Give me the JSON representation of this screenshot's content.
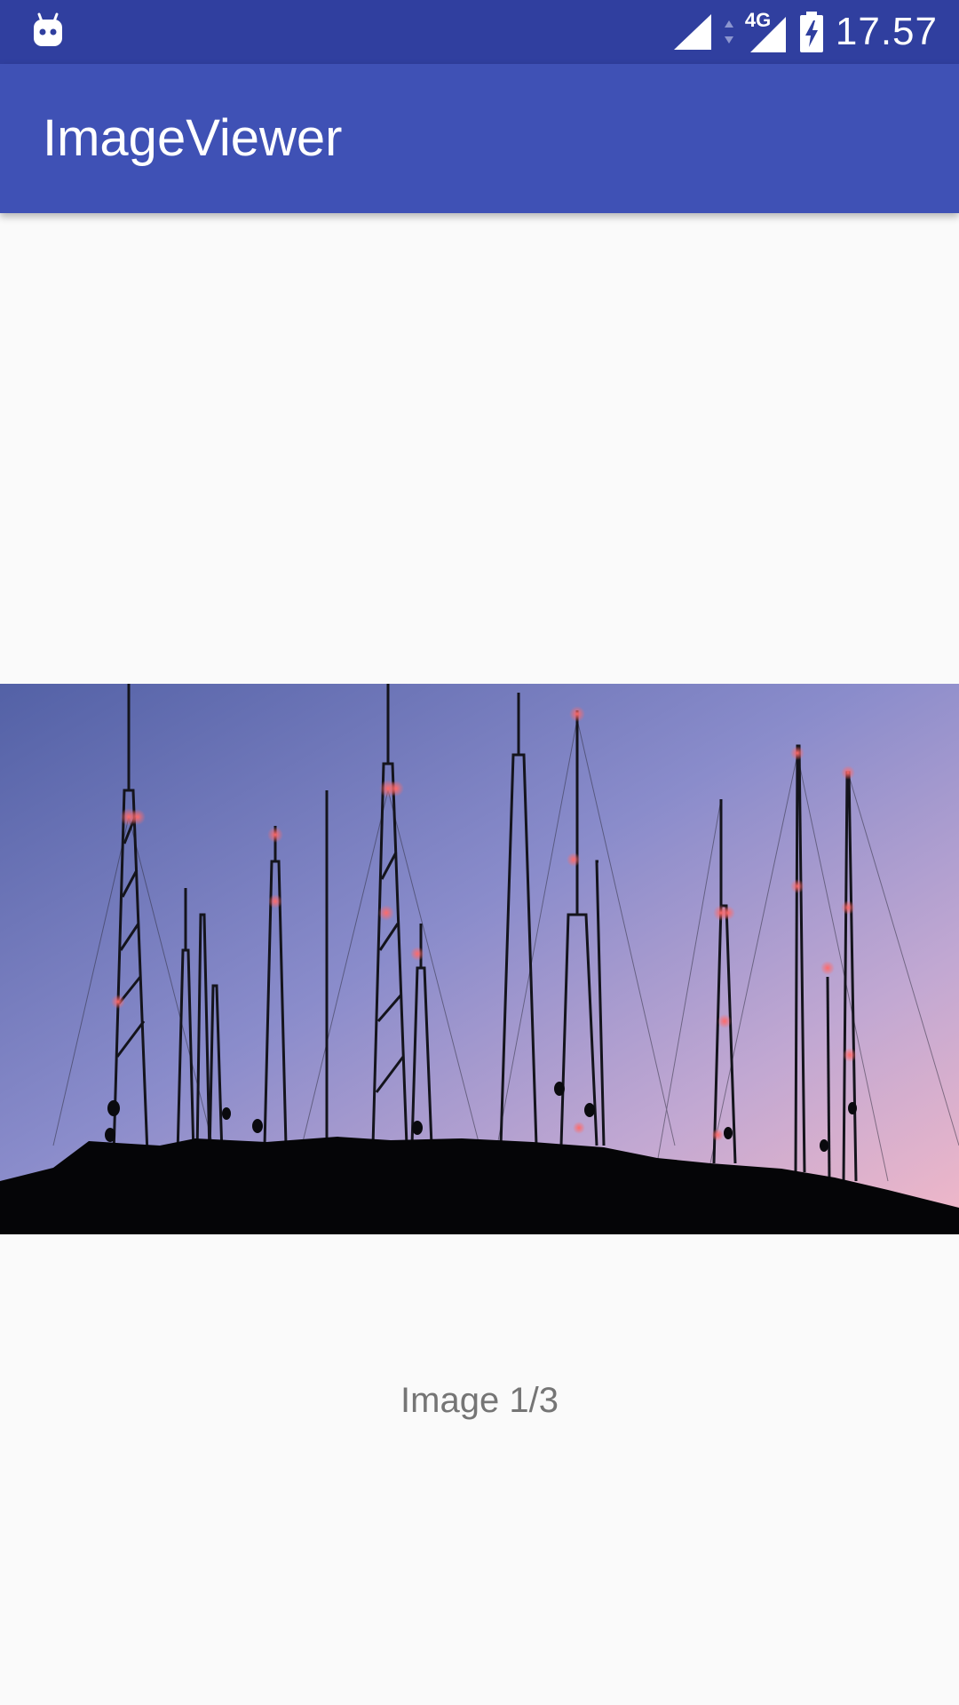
{
  "status_bar": {
    "time": "17.57",
    "network_type": "4G",
    "icons": [
      "android-notification-icon",
      "signal-icon",
      "data-arrows-icon",
      "signal-4g-icon",
      "battery-charging-icon"
    ],
    "color": "#303f9f"
  },
  "app_bar": {
    "title": "ImageViewer",
    "color": "#3f51b5"
  },
  "viewer": {
    "caption": "Image 1/3"
  }
}
